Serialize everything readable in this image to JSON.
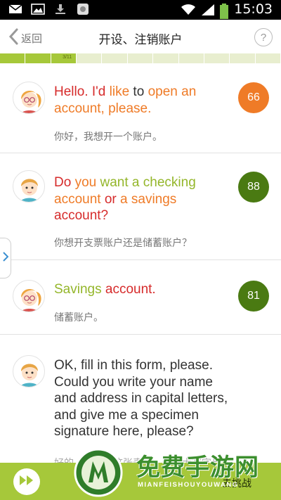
{
  "status_bar": {
    "time": "15:03",
    "left_icons": [
      "mail-icon",
      "image-icon",
      "download-icon",
      "gallery-app-icon"
    ],
    "right_icons": [
      "wifi-icon",
      "signal-icon",
      "battery-icon"
    ]
  },
  "header": {
    "back_label": "返回",
    "title": "开设、注销账户",
    "help_label": "?"
  },
  "progress": {
    "label": "3/11",
    "current": 3,
    "total": 11
  },
  "dialogues": [
    {
      "speaker": "female",
      "words": [
        {
          "t": "Hello.",
          "c": "red"
        },
        {
          "t": "I'd",
          "c": "red"
        },
        {
          "t": "like",
          "c": "orange"
        },
        {
          "t": "to",
          "c": "dark"
        },
        {
          "t": "open",
          "c": "orange"
        },
        {
          "t": "an",
          "c": "orange"
        },
        {
          "t": "account,",
          "c": "orange"
        },
        {
          "t": "please.",
          "c": "orange"
        }
      ],
      "translation": "你好，我想开一个账户。",
      "score": "66",
      "score_color": "#ef7b27"
    },
    {
      "speaker": "male",
      "words": [
        {
          "t": "Do",
          "c": "red"
        },
        {
          "t": "you",
          "c": "orange"
        },
        {
          "t": "want",
          "c": "green"
        },
        {
          "t": "a",
          "c": "green"
        },
        {
          "t": "checking",
          "c": "green"
        },
        {
          "t": "account",
          "c": "orange"
        },
        {
          "t": "or",
          "c": "red"
        },
        {
          "t": "a",
          "c": "orange"
        },
        {
          "t": "savings",
          "c": "orange"
        },
        {
          "t": "account?",
          "c": "red"
        }
      ],
      "translation": "你想开支票账户还是储蓄账户？",
      "score": "88",
      "score_color": "#4a7a12"
    },
    {
      "speaker": "female",
      "words": [
        {
          "t": "Savings",
          "c": "green"
        },
        {
          "t": "account.",
          "c": "red"
        }
      ],
      "translation": "储蓄账户。",
      "score": "81",
      "score_color": "#4a7a12"
    },
    {
      "speaker": "male",
      "words": [
        {
          "t": "OK, fill in this form, please. Could you write your name and address in capital letters, and give me a specimen signature here, please?",
          "c": "dark"
        }
      ],
      "translation": "好的，请填写这张表格。请用大写字母写下你的姓名和地址，并在这里签一个样本签名。"
    }
  ],
  "bottom_bar": {
    "play_icon": "fast-forward-icon",
    "challenge_label": "去挑战"
  },
  "watermark": {
    "text": "免费手游网",
    "sub": "MIANFEISHOUYOUWANG"
  }
}
